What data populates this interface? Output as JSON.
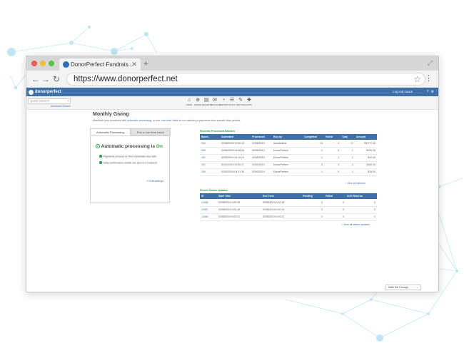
{
  "browser": {
    "tab_title": "DonorPerfect Fundrais...",
    "tab_close": "✕",
    "new_tab": "+",
    "url": "https://www.donorperfect.net"
  },
  "app": {
    "logo": "donorperfect",
    "logout": "Log out Laura",
    "quick_search_placeholder": "Quick Search",
    "advanced_search": "Advanced Search",
    "toolbar": [
      "HOME",
      "ONLINE",
      "RECEIPTS",
      "MAILINGS",
      "REPORTS",
      "TASKS",
      "SETTINGS",
      "APPS"
    ]
  },
  "page": {
    "title": "Monthly Giving",
    "subtitle_pre": "Maximize your donations with",
    "subtitle_link1": "automatic processing",
    "subtitle_mid": ", or use",
    "subtitle_link2": "'one-time' batch",
    "subtitle_post": "to run batches of payments from specific time periods.",
    "tabs": [
      "Automatic Processing",
      "Run a one-time batch"
    ],
    "processing_label": "Automatic processing is",
    "processing_state": "On",
    "notes": [
      "Payments process on their scheduled due date",
      "Daily confirmation emails are sent to 0 recipient"
    ],
    "edit_settings": "Edit settings"
  },
  "batches": {
    "title": "Recently Processed Batches",
    "columns": [
      "Batch..",
      "Submitted",
      "Processed",
      "Run by",
      "Completed",
      "Failed",
      "Total",
      "Amount"
    ],
    "rows": [
      [
        "264",
        "02/08/2019 12:50:43",
        "02/08/2019",
        "laurafeather",
        "13",
        "4",
        "17",
        "$3,277.40"
      ],
      [
        "263",
        "02/06/2019 04:55:44",
        "02/06/2019",
        "DonorPerfect",
        "1",
        "0",
        "1",
        "$100.00"
      ],
      [
        "262",
        "02/05/2019 02:10:21",
        "02/05/2019",
        "DonorPerfect",
        "1",
        "1",
        "2",
        "$10.00"
      ],
      [
        "261",
        "02/04/2019 02:50:27",
        "02/04/2019",
        "DonorPerfect",
        "3",
        "0",
        "3",
        "$160.00"
      ],
      [
        "260",
        "02/03/2019 04:21:30",
        "02/03/2019",
        "DonorPerfect",
        "1",
        "0",
        "1",
        "$15.00"
      ]
    ],
    "view_all": "View all batches"
  },
  "status": {
    "title": "Recent Status Updates",
    "columns": [
      "ID",
      "Start Time",
      "End Time",
      "Pending",
      "Failed",
      "ACH Returns"
    ],
    "rows": [
      [
        "11568",
        "02/08/2019 0:00:18",
        "02/08/2019 0:00:18",
        "0",
        "0",
        "0"
      ],
      [
        "11567",
        "02/08/2019 0:00:16",
        "02/08/2019 0:00:16",
        "0",
        "0",
        "0"
      ],
      [
        "11566",
        "02/08/2019 0:00:21",
        "02/08/2019 0:00:21",
        "0",
        "0",
        "0"
      ]
    ],
    "view_all": "View all status updates"
  },
  "walk_me": "Walk Me Through",
  "colors": {
    "header": "#3e6fa6",
    "accent_green": "#2e9e44",
    "deco": "#bfe6f2"
  }
}
